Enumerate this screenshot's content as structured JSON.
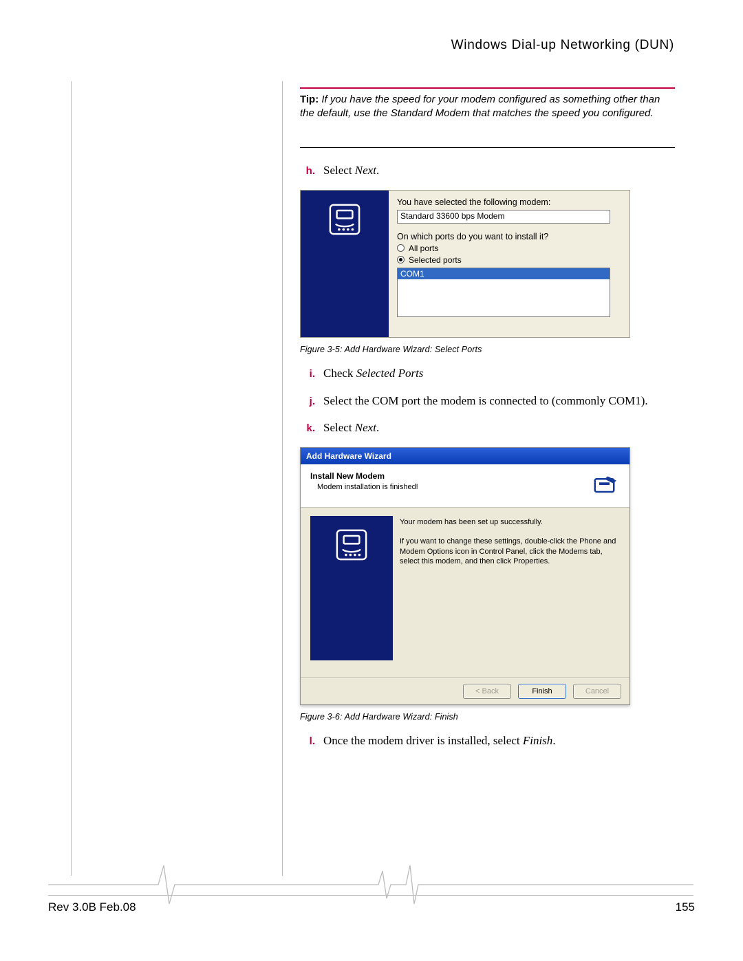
{
  "header": {
    "title": "Windows Dial-up Networking (DUN)"
  },
  "tip": {
    "label": "Tip:",
    "text": "If you have the speed for your modem configured as something other than the default, use the Standard Modem that matches the speed you configured."
  },
  "steps": {
    "h": {
      "marker": "h.",
      "pre": "Select ",
      "em": "Next",
      "post": "."
    },
    "i": {
      "marker": "i.",
      "pre": "Check ",
      "em": "Selected Ports"
    },
    "j": {
      "marker": "j.",
      "text": "Select the COM port the modem is connected to (commonly COM1)."
    },
    "k": {
      "marker": "k.",
      "pre": "Select ",
      "em": "Next",
      "post": "."
    },
    "l": {
      "marker": "l.",
      "pre": "Once the modem driver is installed, select ",
      "em": "Finish",
      "post": "."
    }
  },
  "fig35": {
    "line1": "You have selected the following modem:",
    "modem": "Standard 33600 bps Modem",
    "line2": "On which ports do you want to install it?",
    "radio_all": "All ports",
    "radio_sel": "Selected ports",
    "port": "COM1",
    "caption": "Figure 3-5: Add Hardware Wizard: Select Ports"
  },
  "fig36": {
    "titlebar": "Add Hardware Wizard",
    "top_title": "Install New Modem",
    "top_sub": "Modem installation is finished!",
    "body1": "Your modem has been set up successfully.",
    "body2": "If you want to change these settings, double-click the Phone and Modem Options icon in Control Panel, click the Modems tab, select this modem, and then click Properties.",
    "btn_back": "< Back",
    "btn_finish": "Finish",
    "btn_cancel": "Cancel",
    "caption": "Figure 3-6: Add Hardware Wizard: Finish"
  },
  "footer": {
    "rev": "Rev 3.0B Feb.08",
    "page": "155"
  }
}
